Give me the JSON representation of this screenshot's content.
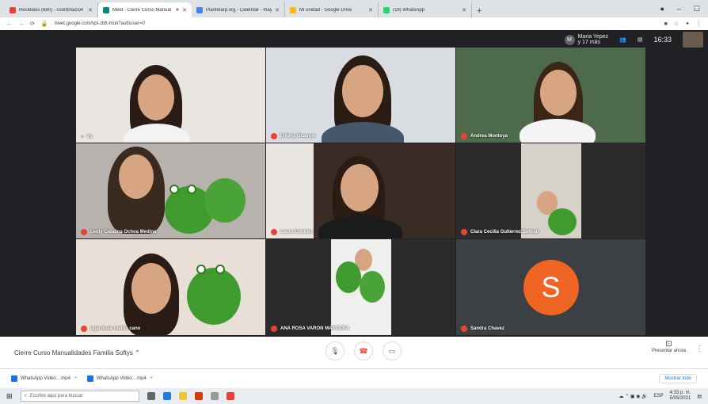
{
  "browser": {
    "tabs": [
      {
        "label": "Recibidos (680) - coordinacion",
        "favicon_color": "#ea4335",
        "active": false
      },
      {
        "label": "Meet - Cierre Curso Manual",
        "favicon_color": "#00897b",
        "active": true
      },
      {
        "label": "Plantelarp.org - Calendar - mayo",
        "favicon_color": "#4285f4",
        "active": false
      },
      {
        "label": "Mi unidad - Google Drive",
        "favicon_color": "#fbbc04",
        "active": false
      },
      {
        "label": "(18) WhatsApp",
        "favicon_color": "#25d366",
        "active": false
      }
    ],
    "url": "meet.google.com/vpi-zbtt-mun?authuser=0",
    "new_tab": "+"
  },
  "meet": {
    "user_name": "Maria Yepez",
    "user_more": "y 17 más",
    "user_initial": "M",
    "time": "16:33",
    "tiles": [
      {
        "name": "Yo",
        "muted": false,
        "kind": "person",
        "bg": "#e9e6e1"
      },
      {
        "name": "Liliana Ocampo",
        "muted": true,
        "kind": "person",
        "bg": "#d9dde2"
      },
      {
        "name": "Andrea Montoya",
        "muted": true,
        "kind": "person",
        "bg": "#4d6b4a"
      },
      {
        "name": "Leidy Catalina Ochoa Medina",
        "muted": true,
        "kind": "frog",
        "bg": "#b8b2ae"
      },
      {
        "name": "Laura Cubides",
        "muted": true,
        "kind": "person",
        "bg": "#3a2c25"
      },
      {
        "name": "Clara Cecilia Gutierrez Beltrán",
        "muted": true,
        "kind": "frog",
        "bg": "#d6d1c9"
      },
      {
        "name": "olga lucia triviño cano",
        "muted": true,
        "kind": "frog",
        "bg": "#e8dfd6"
      },
      {
        "name": "ANA ROSA VARON MANCERA",
        "muted": true,
        "kind": "frog",
        "bg": "#2b2b2b"
      },
      {
        "name": "Sandra Chavez",
        "muted": true,
        "kind": "avatar",
        "initial": "S",
        "bg": "#3c4043"
      }
    ],
    "meeting_title": "Cierre Curso Manualidades Familia Softys",
    "present_label": "Presentar ahora"
  },
  "downloads": {
    "items": [
      "WhatsApp Video....mp4",
      "WhatsApp Video....mp4"
    ],
    "show_all": "Mostrar todo"
  },
  "taskbar": {
    "search_placeholder": "Escribe aquí para buscar",
    "time": "4:33 p. m.",
    "date": "5/05/2021",
    "lang": "ESP"
  }
}
